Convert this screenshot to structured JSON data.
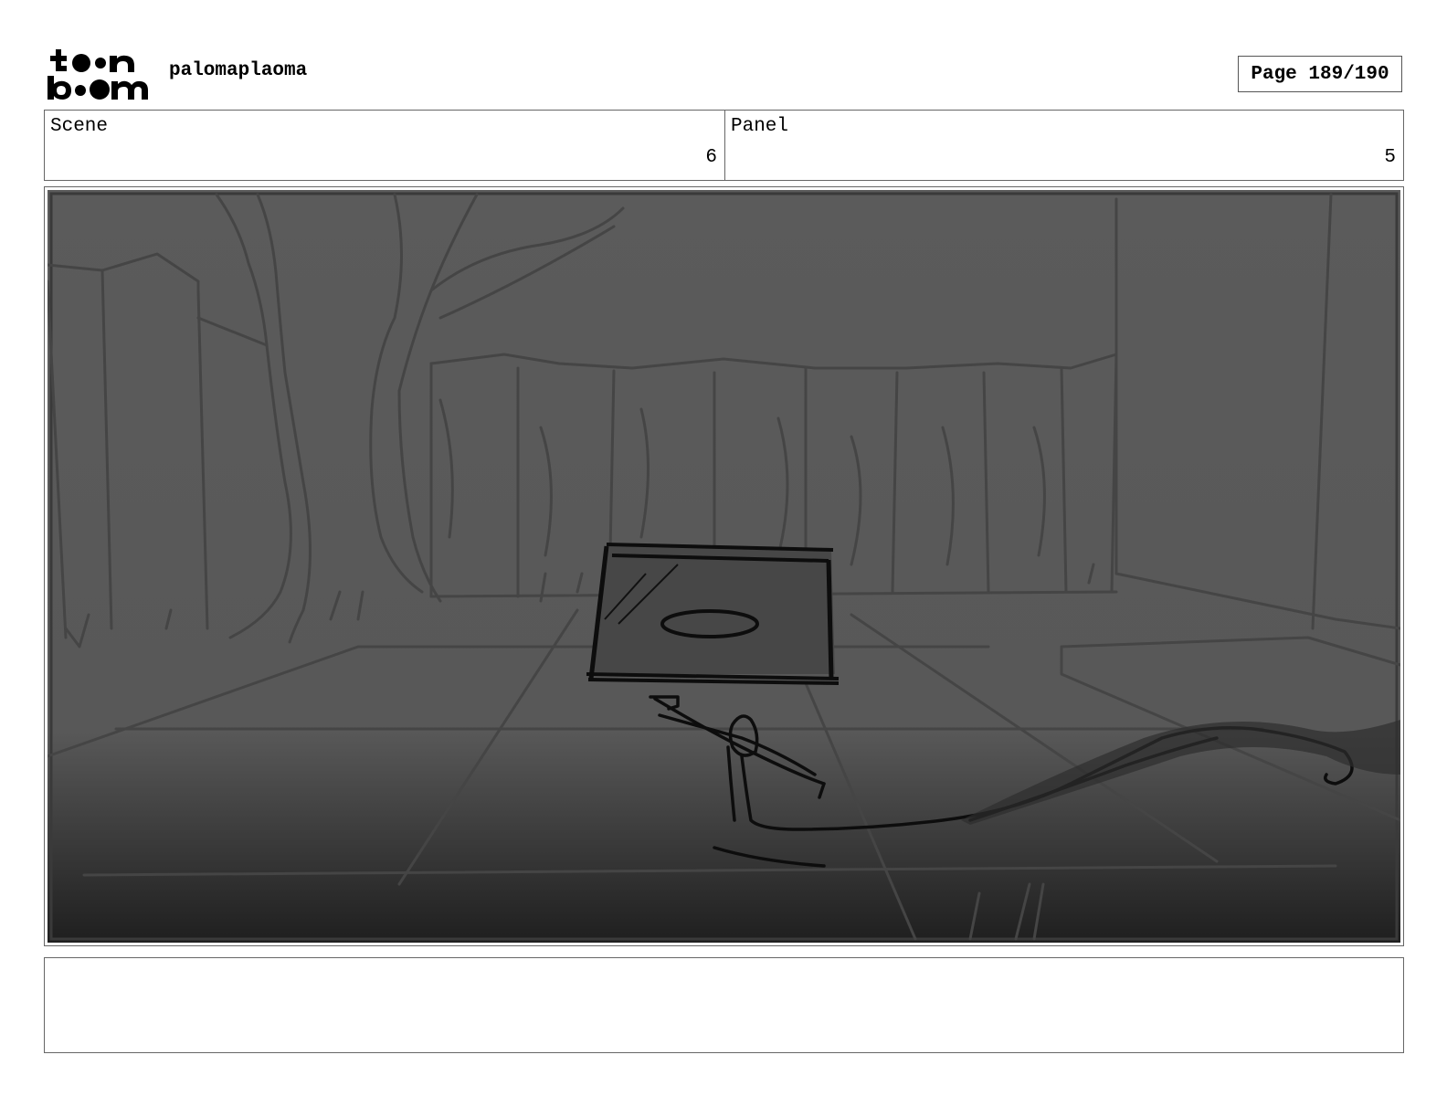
{
  "header": {
    "logo_text": "toon boom",
    "project_name": "palomaplaoma",
    "page_label": "Page 189/190"
  },
  "info": {
    "scene_label": "Scene",
    "scene_value": "6",
    "panel_label": "Panel",
    "panel_value": "5"
  },
  "panel_image": {
    "icon": "storyboard-sketch-image",
    "background_color": "#5a5a5a"
  },
  "notes": {
    "text": ""
  }
}
